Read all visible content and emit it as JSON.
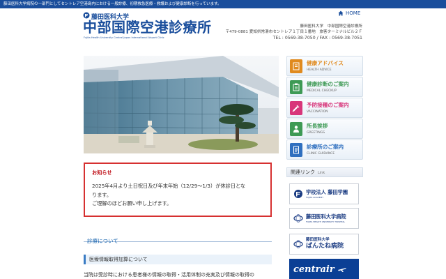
{
  "topbar": {
    "text": "藤田医科大学病院の一部門としてセントレア空港島内における一般診療、初期救急医療・救護および健康診断を行っています。"
  },
  "header": {
    "logo_sub": "藤田医科大学",
    "logo_main": "中部国際空港診療所",
    "logo_en": "Fujita Health University Central Japan International Airport Clinic",
    "home_link": "HOME",
    "address_name": "藤田医科大学　中部国際空港診療所",
    "address_line": "〒479-0881 愛知県常滑市セントレア１丁目１番地　旅客ターミナルビル２Ｆ",
    "contact": "TEL : 0569-38-7050 / FAX : 0569-38-7051"
  },
  "notice": {
    "title": "お知らせ",
    "line1": "2025年4月より土日祝日及び年末年始（12/29〜1/3）が休診日とな",
    "line2": "ります。",
    "line3": "ご理解のほどお願い申し上げます。"
  },
  "main": {
    "section_title": "診療について",
    "subsection_title": "医療情報取得加算について",
    "text": "当院は受診時における患者様の情報の取得・活用体制の充実及び情報の取得の"
  },
  "nav": {
    "items": [
      {
        "jp": "健康アドバイス",
        "en": "HEALTH ADVICE",
        "color": "#e08a1e",
        "icon": "notepad-icon"
      },
      {
        "jp": "健康診断のご案内",
        "en": "MEDICAL CHECKUP",
        "color": "#3e9a55",
        "icon": "clipboard-icon"
      },
      {
        "jp": "予防接種のご案内",
        "en": "VACCINATION",
        "color": "#d8357a",
        "icon": "syringe-icon"
      },
      {
        "jp": "所長挨拶",
        "en": "GREETINGS",
        "color": "#3e9a55",
        "icon": "doctor-icon"
      },
      {
        "jp": "診療所のご案内",
        "en": "CLINIC GUIDANCE",
        "color": "#2f6fbf",
        "icon": "document-icon"
      }
    ]
  },
  "links": {
    "title": "関連リンク",
    "title_en": "Link",
    "banner1_jp": "学校法人 藤田学園",
    "banner1_en": "FUJITA ACADEMY",
    "banner2_jp": "藤田医科大学病院",
    "banner2_en": "FUJITA HEALTH UNIVERSITY HOSPITAL",
    "banner3_small": "藤田医科大学",
    "banner3_big": "ばんたね病院",
    "banner4": "centrair"
  },
  "colors": {
    "brand": "#1a4e9c",
    "notice_border": "#d63030",
    "notice_title": "#c0141c"
  }
}
